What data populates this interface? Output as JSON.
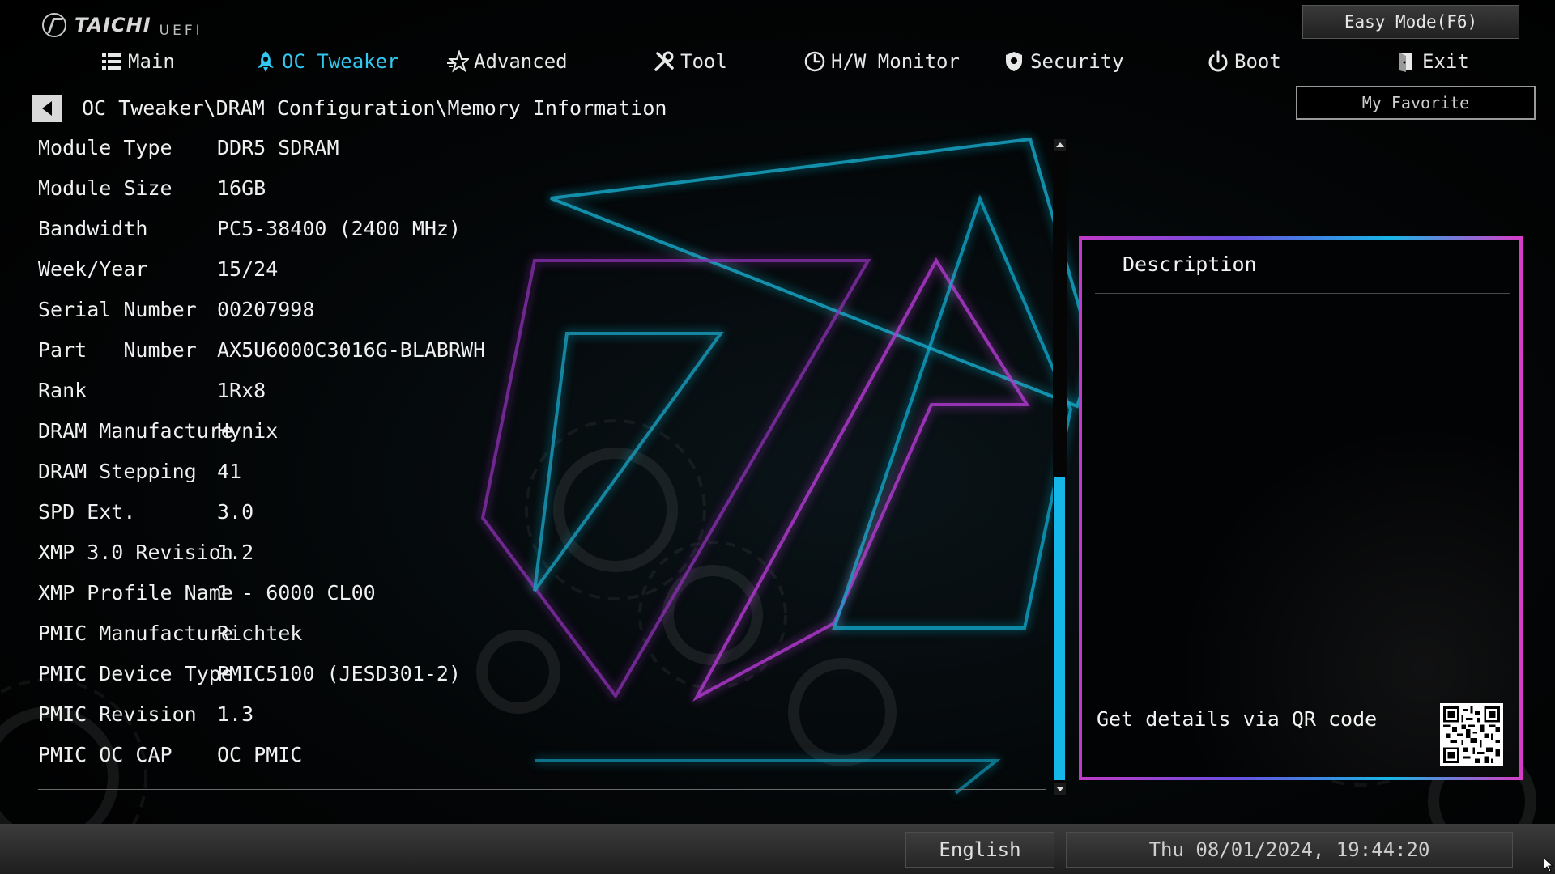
{
  "brand": {
    "name": "TAICHI",
    "sub": "UEFI"
  },
  "header": {
    "easy_mode_label": "Easy Mode(F6)",
    "favorite_label": "My Favorite"
  },
  "nav": {
    "tabs": [
      {
        "label": "Main",
        "icon": "list-icon",
        "active": false
      },
      {
        "label": "OC Tweaker",
        "icon": "rocket-icon",
        "active": true
      },
      {
        "label": "Advanced",
        "icon": "star-icon",
        "active": false
      },
      {
        "label": "Tool",
        "icon": "wrench-icon",
        "active": false
      },
      {
        "label": "H/W Monitor",
        "icon": "monitor-gauge-icon",
        "active": false
      },
      {
        "label": "Security",
        "icon": "shield-icon",
        "active": false
      },
      {
        "label": "Boot",
        "icon": "power-icon",
        "active": false
      },
      {
        "label": "Exit",
        "icon": "exit-door-icon",
        "active": false
      }
    ]
  },
  "breadcrumb": "OC Tweaker\\DRAM Configuration\\Memory Information",
  "memory_info": [
    {
      "label": "Module Type",
      "value": "DDR5 SDRAM"
    },
    {
      "label": "Module Size",
      "value": "16GB"
    },
    {
      "label": "Bandwidth",
      "value": "PC5-38400 (2400 MHz)"
    },
    {
      "label": "Week/Year",
      "value": "15/24"
    },
    {
      "label": "Serial Number",
      "value": "00207998"
    },
    {
      "label": "Part   Number",
      "value": "AX5U6000C3016G-BLABRWH"
    },
    {
      "label": "Rank",
      "value": "1Rx8"
    },
    {
      "label": "DRAM Manufacture",
      "value": "Hynix"
    },
    {
      "label": "DRAM Stepping",
      "value": "41"
    },
    {
      "label": "SPD Ext.",
      "value": "3.0"
    },
    {
      "label": "XMP 3.0 Revision",
      "value": "1.2"
    },
    {
      "label": "XMP Profile Name",
      "value": "1 - 6000 CL00"
    },
    {
      "label": "PMIC Manufacture",
      "value": "Richtek"
    },
    {
      "label": "PMIC Device Type",
      "value": "PMIC5100 (JESD301-2)"
    },
    {
      "label": "PMIC Revision",
      "value": "1.3"
    },
    {
      "label": "PMIC OC CAP",
      "value": "OC PMIC"
    }
  ],
  "description": {
    "title": "Description",
    "qr_text": "Get details via QR code"
  },
  "footer": {
    "language": "English",
    "datetime": "Thu 08/01/2024, 19:44:20"
  },
  "colors": {
    "accent": "#33c8f0",
    "scroll_thumb": "#15b7e8",
    "panel_pink": "#d93cc7",
    "panel_cyan": "#18b6e6"
  }
}
